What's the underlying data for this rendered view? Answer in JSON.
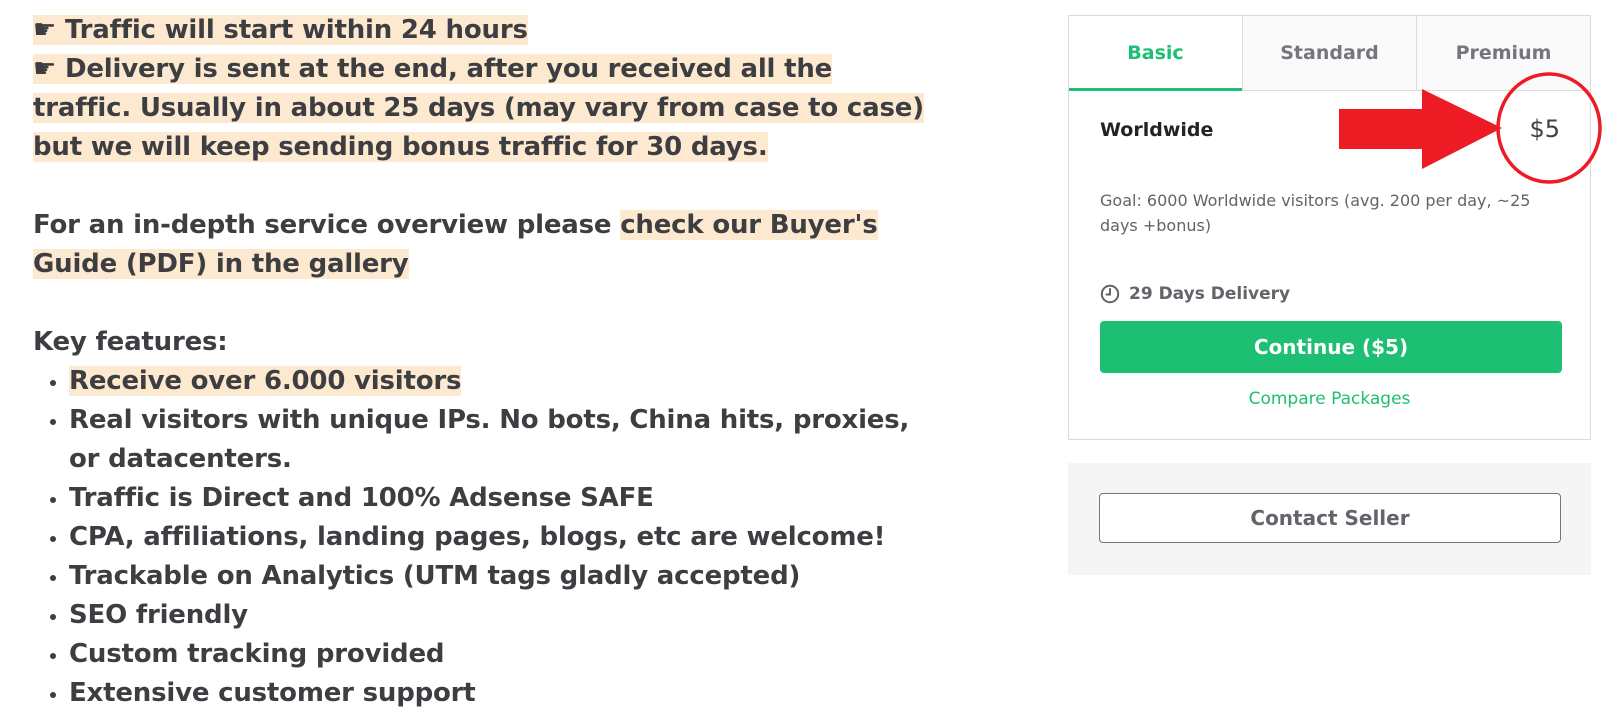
{
  "description": {
    "bullet_lines": [
      "☛ Traffic will start within 24 hours",
      "☛ Delivery is sent at the end, after you received all the traffic. Usually in about 25 days (may vary from case to case) but we will keep sending bonus traffic for 30 days."
    ],
    "overview_prefix": "For an in-depth service overview please ",
    "overview_link": "check our Buyer's Guide (PDF) in the gallery",
    "features_heading": "Key features:",
    "features": [
      "Receive over 6.000 visitors",
      "Real visitors with unique IPs. No bots, China hits, proxies, or datacenters.",
      "Traffic is Direct and 100% Adsense SAFE",
      "CPA, affiliations, landing pages, blogs, etc are welcome!",
      "Trackable on Analytics (UTM tags gladly accepted)",
      "SEO friendly",
      "Custom tracking provided",
      "Extensive customer support"
    ],
    "highlight_color": "#fde9cf"
  },
  "package_card": {
    "tabs": [
      "Basic",
      "Standard",
      "Premium"
    ],
    "active_tab": "Basic",
    "title": "Worldwide",
    "price": "$5",
    "description": "Goal: 6000 Worldwide visitors (avg. 200 per day, ~25 days +bonus)",
    "delivery_icon": "clock-icon",
    "delivery": "29 Days Delivery",
    "continue_label": "Continue ($5)",
    "compare_label": "Compare Packages",
    "accent_color": "#1dbf73"
  },
  "contact": {
    "button_label": "Contact Seller"
  },
  "annotation": {
    "arrow_icon": "red-arrow-icon",
    "circle_icon": "red-circle-icon",
    "color": "#ed1c24"
  }
}
